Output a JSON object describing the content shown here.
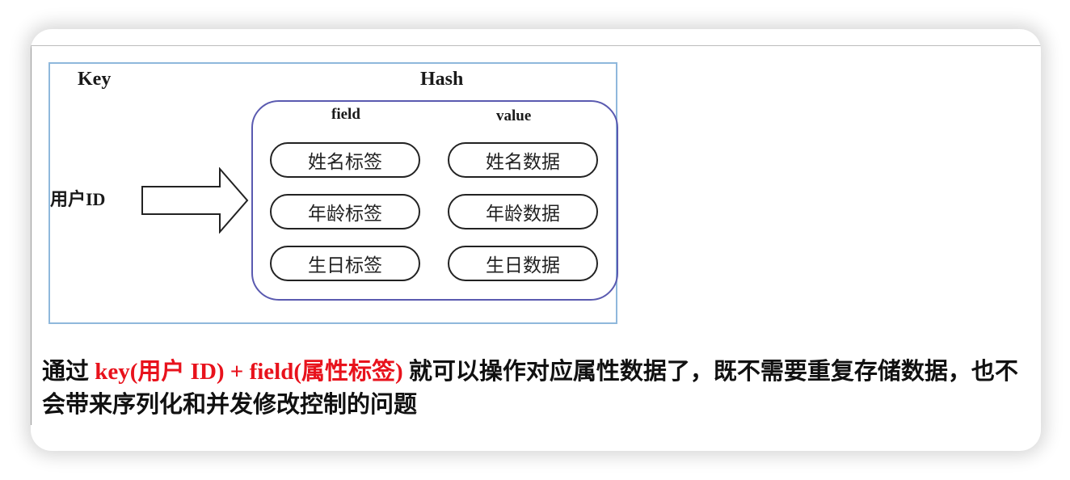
{
  "diagram": {
    "key_label": "Key",
    "hash_label": "Hash",
    "user_id_label": "用户ID",
    "field_header": "field",
    "value_header": "value",
    "rows": [
      {
        "field": "姓名标签",
        "value": "姓名数据"
      },
      {
        "field": "年龄标签",
        "value": "年龄数据"
      },
      {
        "field": "生日标签",
        "value": "生日数据"
      }
    ]
  },
  "caption": {
    "prefix": "通过 ",
    "highlight": "key(用户  ID) + field(属性标签)",
    "suffix": " 就可以操作对应属性数据了，既不需要重复存储数据，也不会带来序列化和并发修改控制的问题"
  },
  "colors": {
    "highlight": "#e8121c",
    "diagram_border": "#8fb8dc",
    "hash_border": "#5a5ab0"
  }
}
